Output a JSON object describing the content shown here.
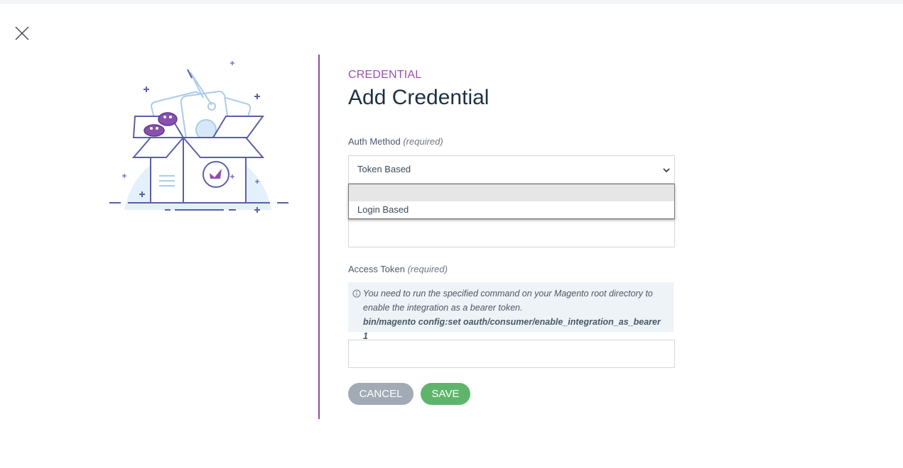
{
  "modal": {
    "eyebrow": "CREDENTIAL",
    "title": "Add Credential"
  },
  "auth_method": {
    "label": "Auth Method",
    "required": "(required)",
    "selected": "Token Based",
    "options": [
      "",
      "Login Based"
    ]
  },
  "access_token": {
    "label": "Access Token",
    "required": "(required)",
    "info_line1": "You need to run the specified command on your Magento root directory to",
    "info_line2": "enable the integration as a bearer token.",
    "info_command": "bin/magento config:set oauth/consumer/enable_integration_as_bearer 1",
    "value": ""
  },
  "buttons": {
    "cancel": "CANCEL",
    "save": "SAVE"
  },
  "colors": {
    "accent_purple": "#9b4fb0",
    "divider": "#8b4f9e",
    "title": "#1d3144",
    "cancel_bg": "#a2aab5",
    "save_bg": "#5fb46c",
    "info_bg": "#eef3f8"
  },
  "icons": {
    "close": "close-icon",
    "chevron": "chevron-down-icon",
    "info": "info-icon",
    "illustration": "box-with-tags-illustration"
  }
}
